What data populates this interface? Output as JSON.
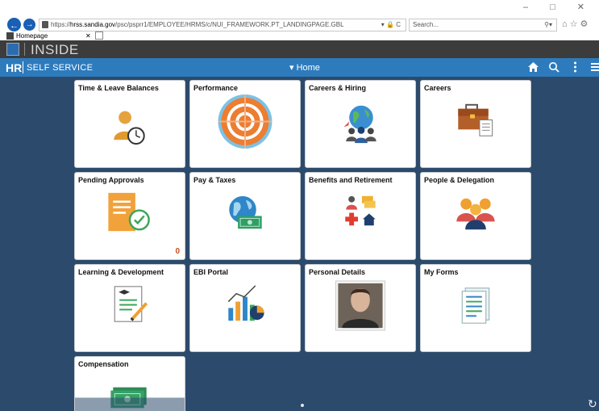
{
  "browser": {
    "url_scheme": "https://",
    "url_domain": "hrss.sandia.gov",
    "url_path": "/psc/psprr1/EMPLOYEE/HRMS/c/NUI_FRAMEWORK.PT_LANDINGPAGE.GBL",
    "address_right": "▾ 🔒 C",
    "search_placeholder": "Search...",
    "tab_title": "Homepage",
    "win_controls": "–  □  ✕"
  },
  "inside": {
    "title": "INSIDE"
  },
  "header": {
    "brand": "HR",
    "subtitle": "SELF SERVICE",
    "home_label": "▾ Home"
  },
  "tiles": [
    {
      "title": "Time & Leave Balances"
    },
    {
      "title": "Performance"
    },
    {
      "title": "Careers & Hiring"
    },
    {
      "title": "Careers"
    },
    {
      "title": "Pending Approvals",
      "count": "0"
    },
    {
      "title": "Pay & Taxes"
    },
    {
      "title": "Benefits and Retirement"
    },
    {
      "title": "People & Delegation"
    },
    {
      "title": "Learning & Development"
    },
    {
      "title": "EBI Portal"
    },
    {
      "title": "Personal Details"
    },
    {
      "title": "My Forms"
    },
    {
      "title": "Compensation"
    }
  ],
  "colors": {
    "page_bg": "#2c4a6b",
    "hr_bar": "#2d7bbd",
    "inside_bar": "#3c3c3c",
    "pending_count": "#c8501c"
  }
}
